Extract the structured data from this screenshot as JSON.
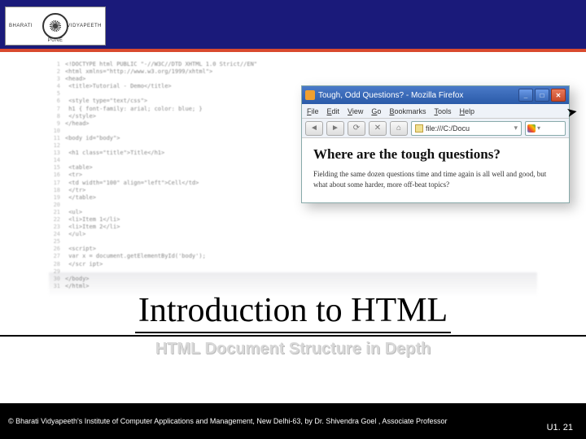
{
  "logo": {
    "left_text": "BHARATI",
    "right_text": "VIDYAPEETH",
    "bottom_text": "PUNE"
  },
  "browser": {
    "title": "Tough, Odd Questions? - Mozilla Firefox",
    "menu": {
      "file": "File",
      "edit": "Edit",
      "view": "View",
      "go": "Go",
      "bookmarks": "Bookmarks",
      "tools": "Tools",
      "help": "Help"
    },
    "url": "file:///C:/Docu",
    "nav": {
      "back": "◄",
      "fwd": "►",
      "reload": "⟳",
      "stop": "✕",
      "home": "⌂"
    },
    "win": {
      "min": "_",
      "max": "□",
      "close": "✕"
    },
    "headline": "Where are the tough questions?",
    "body": "Fielding the same dozen questions time and time again is all well and good, but what about some harder, more off-beat topics?"
  },
  "titles": {
    "main": "Introduction to HTML",
    "sub": "HTML Document Structure in Depth"
  },
  "footer": {
    "copyright": "© Bharati Vidyapeeth's Institute of Computer Applications and Management, New Delhi-63, by Dr. Shivendra Goel , Associate Professor",
    "page": "U1. 21"
  },
  "code_sample": [
    "<!DOCTYPE html PUBLIC \"-//W3C//DTD XHTML 1.0 Strict//EN\"",
    "<html xmlns=\"http://www.w3.org/1999/xhtml\">",
    "<head>",
    "  <title>Tutorial - Demo</title>",
    "",
    "  <style type=\"text/css\">",
    "    h1 { font-family: arial; color: blue; }",
    "  </style>",
    "</head>",
    "",
    "<body id=\"body\">",
    "",
    "  <h1 class=\"title\">Title</h1>",
    "",
    "  <table>",
    "    <tr>",
    "      <td width=\"100\" align=\"left\">Cell</td>",
    "    </tr>",
    "  </table>",
    "",
    "  <ul>",
    "    <li>Item 1</li>",
    "    <li>Item 2</li>",
    "  </ul>",
    "",
    "  <script>",
    "    var x = document.getElementById('body');",
    "  </scr ipt>",
    "",
    "</body>",
    "</html>"
  ]
}
